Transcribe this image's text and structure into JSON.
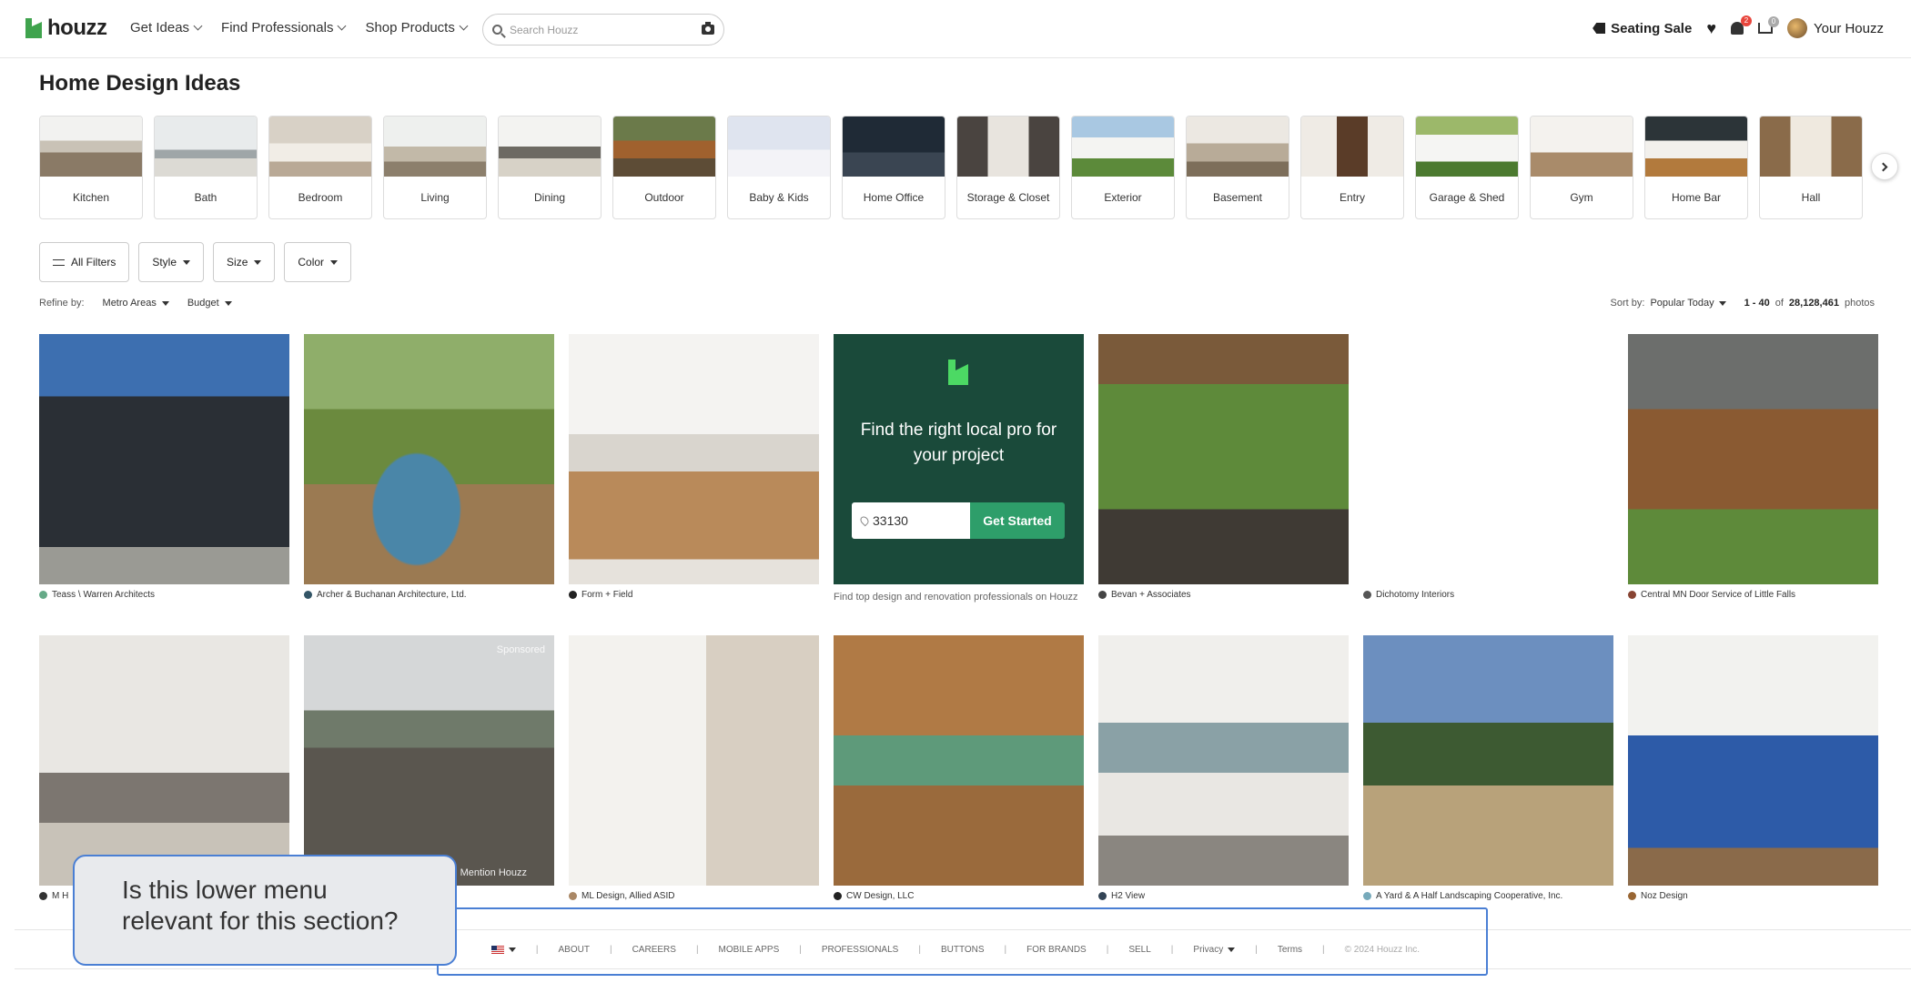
{
  "brand": {
    "name": "houzz"
  },
  "nav": {
    "items": [
      "Get Ideas",
      "Find Professionals",
      "Shop Products"
    ]
  },
  "search": {
    "placeholder": "Search Houzz"
  },
  "header_right": {
    "sale": "Seating Sale",
    "notif_count": "2",
    "cart_count": "0",
    "account": "Your Houzz"
  },
  "page": {
    "title": "Home Design Ideas"
  },
  "categories": [
    "Kitchen",
    "Bath",
    "Bedroom",
    "Living",
    "Dining",
    "Outdoor",
    "Baby & Kids",
    "Home Office",
    "Storage & Closet",
    "Exterior",
    "Basement",
    "Entry",
    "Garage & Shed",
    "Gym",
    "Home Bar",
    "Hall"
  ],
  "filters": {
    "all": "All Filters",
    "style": "Style",
    "size": "Size",
    "color": "Color"
  },
  "refine": {
    "label": "Refine by:",
    "metro": "Metro Areas",
    "budget": "Budget"
  },
  "sort": {
    "label": "Sort by:",
    "value": "Popular Today",
    "range": "1 - 40",
    "of": "of",
    "total": "28,128,461",
    "unit": "photos"
  },
  "promo": {
    "title": "Find the right local pro for your project",
    "zip": "33130",
    "cta": "Get Started",
    "subtitle": "Find top design and renovation professionals on Houzz"
  },
  "photos": [
    {
      "credit": "Teass \\ Warren Architects",
      "sponsored": ""
    },
    {
      "credit": "Archer & Buchanan Architecture, Ltd.",
      "sponsored": ""
    },
    {
      "credit": "Form + Field",
      "sponsored": ""
    },
    {
      "credit": "Bevan + Associates",
      "sponsored": ""
    },
    {
      "credit": "Dichotomy Interiors",
      "sponsored": ""
    },
    {
      "credit": "Central MN Door Service of Little Falls",
      "sponsored": ""
    },
    {
      "credit": "M H",
      "sponsored": ""
    },
    {
      "credit": "",
      "sponsored": "Sponsored"
    },
    {
      "credit": "ML Design, Allied ASID",
      "sponsored": ""
    },
    {
      "credit": "CW Design, LLC",
      "sponsored": ""
    },
    {
      "credit": "H2 View",
      "sponsored": ""
    },
    {
      "credit": "A Yard & A Half Landscaping Cooperative, Inc.",
      "sponsored": ""
    },
    {
      "credit": "Noz Design",
      "sponsored": ""
    }
  ],
  "photo_overlay": {
    "mention": "Mention Houzz"
  },
  "footer": {
    "links": [
      "ABOUT",
      "CAREERS",
      "MOBILE APPS",
      "PROFESSIONALS",
      "BUTTONS",
      "FOR BRANDS",
      "SELL"
    ],
    "privacy": "Privacy",
    "terms": "Terms",
    "copyright": "© 2024 Houzz Inc."
  },
  "annotation": {
    "note": "Is this lower menu relevant for this section?"
  },
  "colors": {
    "brand_green": "#3fa34d",
    "promo_bg": "#1a4a3a",
    "cta": "#2e9e6a",
    "annotation_border": "#4a7fd4"
  }
}
